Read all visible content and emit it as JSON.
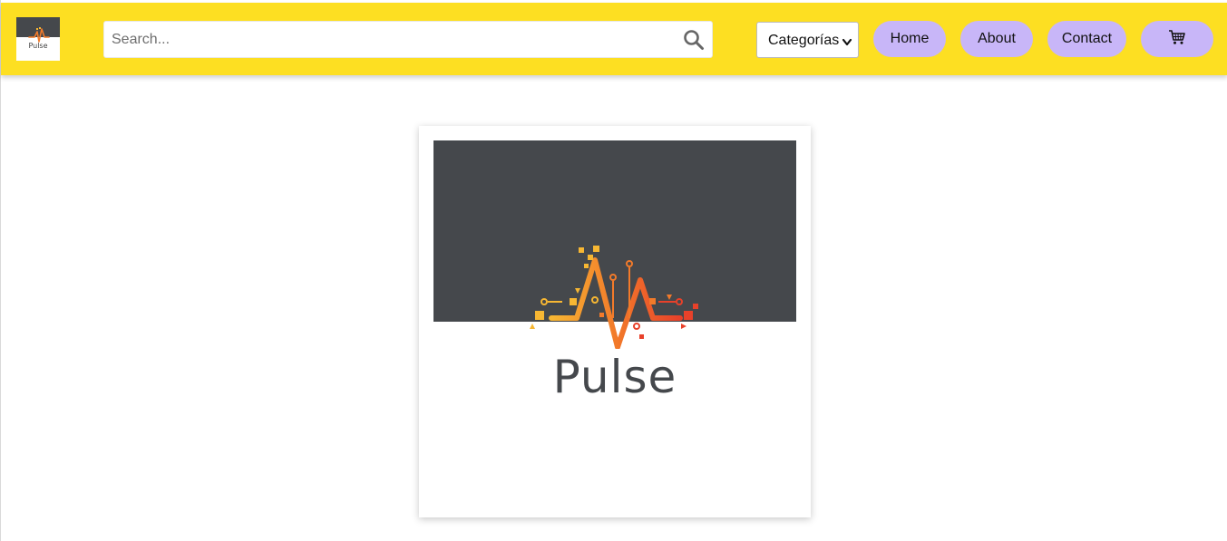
{
  "header": {
    "logo": {
      "wordmark": "Pulse",
      "icon": "pulse-logo-icon"
    },
    "search": {
      "placeholder": "Search...",
      "value": "",
      "icon": "search-icon"
    },
    "category_select": {
      "selected": "Categorías",
      "icon": "chevron-down-icon"
    },
    "nav": [
      {
        "label": "Home"
      },
      {
        "label": "About"
      },
      {
        "label": "Contact"
      }
    ],
    "cart": {
      "icon": "cart-icon"
    },
    "colors": {
      "bar": "#fddf22",
      "pill": "#c8b6f8"
    }
  },
  "main": {
    "product_card": {
      "image": {
        "wordmark": "Pulse",
        "icon": "pulse-heartbeat-icon"
      }
    }
  }
}
